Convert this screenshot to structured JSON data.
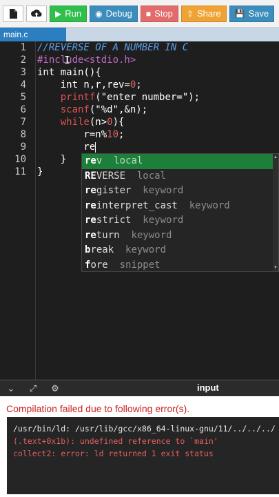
{
  "toolbar": {
    "file_icon": "file-icon",
    "upload_icon": "upload-icon",
    "run": {
      "icon": "play-icon",
      "label": "Run"
    },
    "debug": {
      "icon": "debug-icon",
      "label": "Debug"
    },
    "stop": {
      "icon": "stop-icon",
      "label": "Stop"
    },
    "share": {
      "icon": "share-icon",
      "label": "Share"
    },
    "save": {
      "icon": "save-icon",
      "label": "Save"
    }
  },
  "tabs": [
    {
      "label": "main.c",
      "active": true
    }
  ],
  "editor": {
    "line_numbers": [
      "1",
      "2",
      "3",
      "4",
      "5",
      "6",
      "7",
      "8",
      "9",
      "10",
      "11"
    ],
    "lines": {
      "l1": "//REVERSE OF A NUMBER IN C",
      "l2": "#include<stdio.h>",
      "l3": "int main(){",
      "l4a": "    int n,r,rev=",
      "l4b": "0",
      "l4c": ";",
      "l5a": "    ",
      "l5b": "printf",
      "l5c": "(\"enter number=\");",
      "l6a": "    ",
      "l6b": "scanf",
      "l6c": "(\"%d\",&n);",
      "l7a": "    ",
      "l7b": "while",
      "l7c": "(n>",
      "l7d": "0",
      "l7e": "){",
      "l8a": "        r=n%",
      "l8b": "10",
      "l8c": ";",
      "l9": "        re",
      "l10": "    }",
      "l11": "}"
    }
  },
  "autocomplete": {
    "items": [
      {
        "match": "re",
        "rest": "v",
        "kind": "local",
        "selected": true
      },
      {
        "match": "RE",
        "rest": "VERSE",
        "kind": "local",
        "selected": false
      },
      {
        "match": "re",
        "rest": "gister",
        "kind": "keyword",
        "selected": false
      },
      {
        "match": "re",
        "rest": "interpret_cast",
        "kind": "keyword",
        "selected": false
      },
      {
        "match": "re",
        "rest": "strict",
        "kind": "keyword",
        "selected": false
      },
      {
        "match": "re",
        "rest": "turn",
        "kind": "keyword",
        "selected": false
      },
      {
        "match": "b",
        "rest": "reak",
        "kind": "keyword",
        "selected": false
      },
      {
        "match": "f",
        "rest": "ore",
        "kind": "snippet",
        "selected": false
      }
    ]
  },
  "panel": {
    "icons": [
      "chevron-down-icon",
      "expand-icon",
      "settings-icon"
    ],
    "title": "input"
  },
  "output": {
    "error_title": "Compilation failed due to following error(s).",
    "lines": [
      "/usr/bin/ld: /usr/lib/gcc/x86_64-linux-gnu/11/../../../",
      "(.text+0x1b): undefined reference to `main'",
      "collect2: error: ld returned 1 exit status"
    ]
  },
  "colors": {
    "run": "#2fbf4a",
    "debug": "#3c8dbc",
    "stop": "#e26b6b",
    "share": "#f0a335",
    "save": "#3c8dbc",
    "error_text": "#cc2222",
    "selected_suggestion": "#1e7f3a"
  }
}
